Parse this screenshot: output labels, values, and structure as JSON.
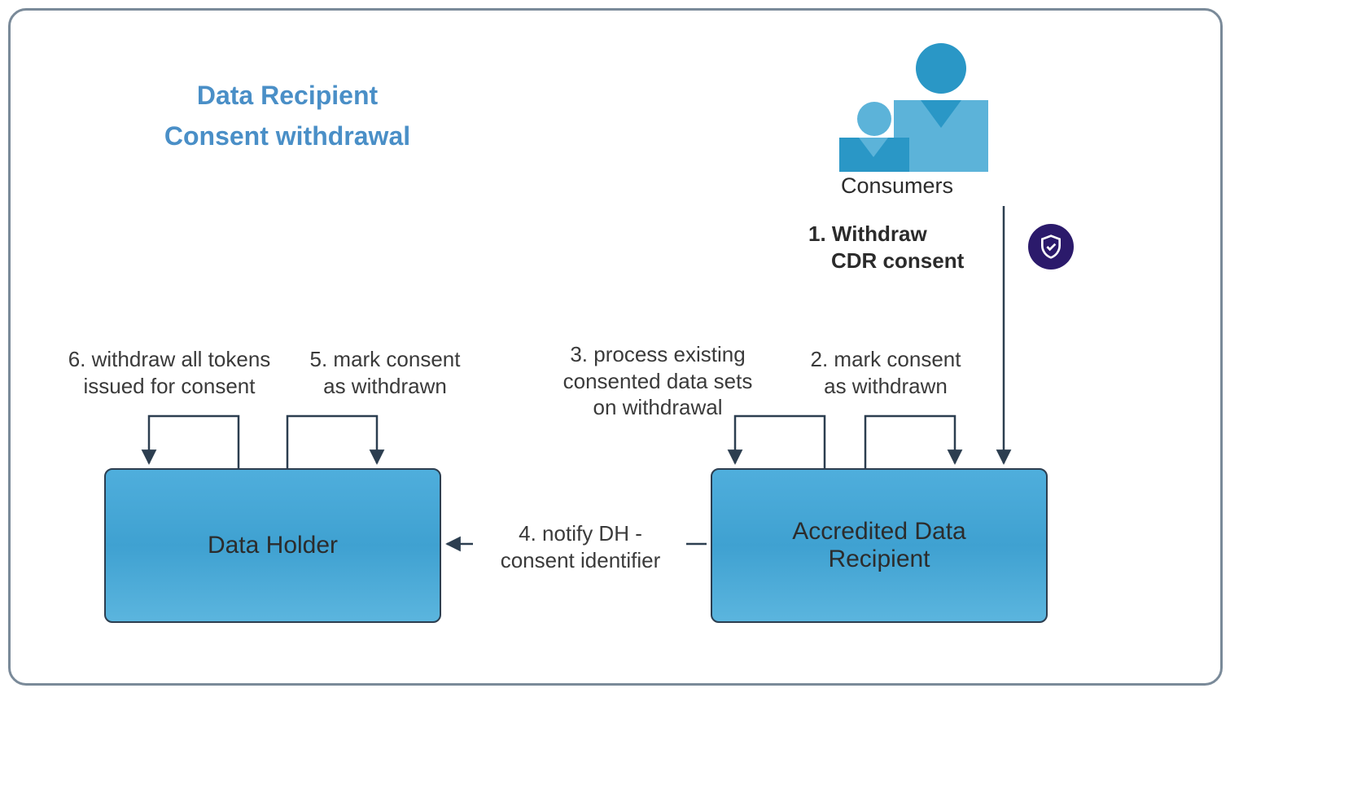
{
  "title_line1": "Data Recipient",
  "title_line2": "Consent withdrawal",
  "consumers_label": "Consumers",
  "boxes": {
    "data_holder": "Data Holder",
    "adr_line1": "Accredited Data",
    "adr_line2": "Recipient"
  },
  "steps": {
    "s1_num": "1.",
    "s1_l1": "Withdraw",
    "s1_l2": "CDR consent",
    "s2_l1": "2. mark consent",
    "s2_l2": "as withdrawn",
    "s3_l1": "3. process existing",
    "s3_l2": "consented data sets",
    "s3_l3": "on withdrawal",
    "s4_l1": "4. notify DH -",
    "s4_l2": "consent identifier",
    "s5_l1": "5. mark consent",
    "s5_l2": "as withdrawn",
    "s6_l1": "6. withdraw all tokens",
    "s6_l2": "issued for consent"
  }
}
